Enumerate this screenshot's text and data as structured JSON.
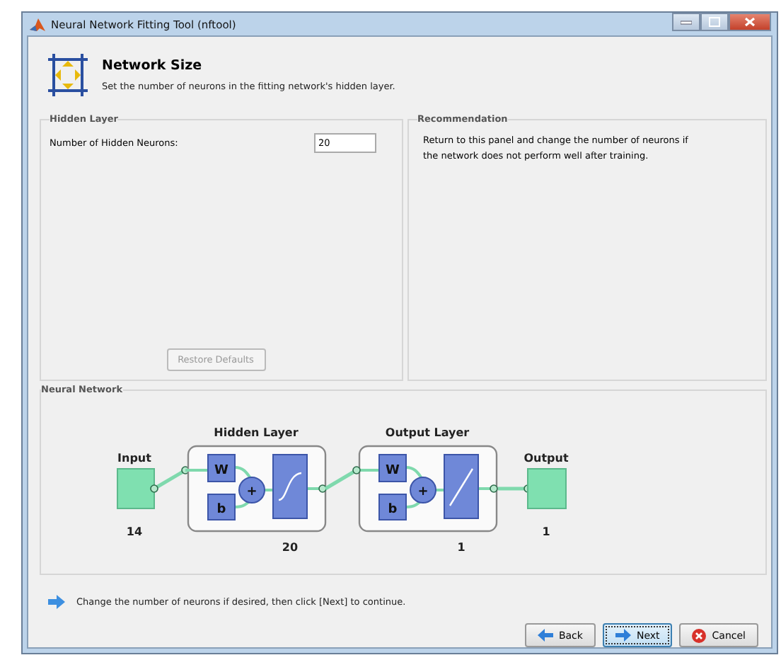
{
  "window": {
    "title": "Neural Network Fitting Tool (nftool)"
  },
  "header": {
    "title": "Network Size",
    "subtitle": "Set the number of neurons in the fitting network's hidden layer."
  },
  "hidden_layer_panel": {
    "title": "Hidden Layer",
    "field_label": "Number of Hidden Neurons:",
    "value": "20",
    "restore_button": {
      "label": "Restore Defaults",
      "disabled": true
    }
  },
  "recommendation_panel": {
    "title": "Recommendation",
    "text": "Return to this panel and change the number of neurons if\nthe network does not perform well after training."
  },
  "network_panel": {
    "title": "Neural Network",
    "input": {
      "label": "Input",
      "size": "14"
    },
    "layers": [
      {
        "title": "Hidden Layer",
        "size": "20",
        "kind": "sigmoid",
        "weight": "W",
        "bias": "b",
        "sum": "+"
      },
      {
        "title": "Output Layer",
        "size": "1",
        "kind": "linear",
        "weight": "W",
        "bias": "b",
        "sum": "+"
      }
    ],
    "output": {
      "label": "Output",
      "size": "1"
    }
  },
  "hint": "Change the number of neurons if desired, then click [Next] to continue.",
  "buttons": [
    {
      "label": "Back",
      "kind": "back",
      "selected": false
    },
    {
      "label": "Next",
      "kind": "next",
      "selected": true
    },
    {
      "label": "Cancel",
      "kind": "cancel",
      "selected": false
    }
  ]
}
